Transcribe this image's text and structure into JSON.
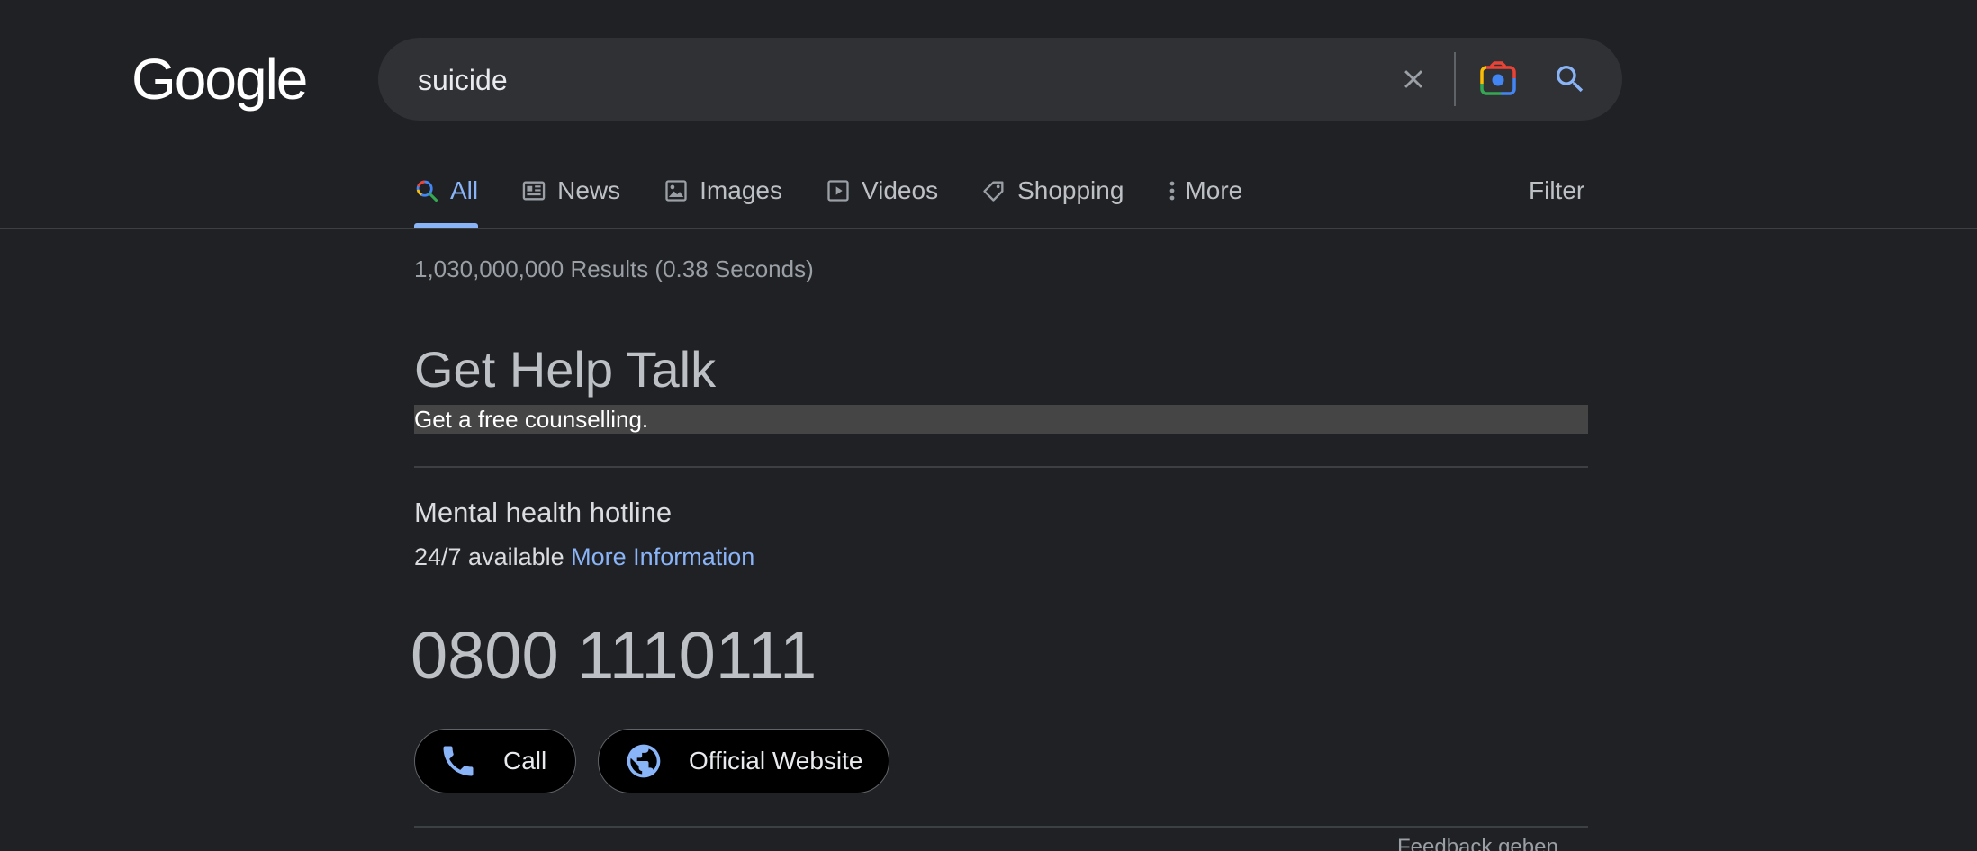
{
  "header": {
    "logo_text": "Google",
    "search": {
      "value": "suicide",
      "clear_icon": "close-icon",
      "lens_icon": "google-lens-icon",
      "search_icon": "search-icon"
    }
  },
  "tabs": [
    {
      "label": "All",
      "icon": "search-icon",
      "active": true
    },
    {
      "label": "News",
      "icon": "news-icon",
      "active": false
    },
    {
      "label": "Images",
      "icon": "image-icon",
      "active": false
    },
    {
      "label": "Videos",
      "icon": "video-icon",
      "active": false
    },
    {
      "label": "Shopping",
      "icon": "tag-icon",
      "active": false
    },
    {
      "label": "More",
      "icon": "more-vert-icon",
      "active": false
    }
  ],
  "filter_label": "Filter",
  "results_stats": "1,030,000,000 Results (0.38 Seconds)",
  "help_panel": {
    "title": "Get Help Talk",
    "subtitle": "Get a free counselling.",
    "hotline_title": "Mental health hotline",
    "availability": "24/7 available",
    "more_info_link": "More Information",
    "phone_number": "0800 1110111",
    "call_label": "Call",
    "website_label": "Official Website"
  },
  "feedback_label": "Feedback geben",
  "colors": {
    "background": "#202124",
    "accent": "#8ab4f8",
    "searchbar": "#303134"
  }
}
